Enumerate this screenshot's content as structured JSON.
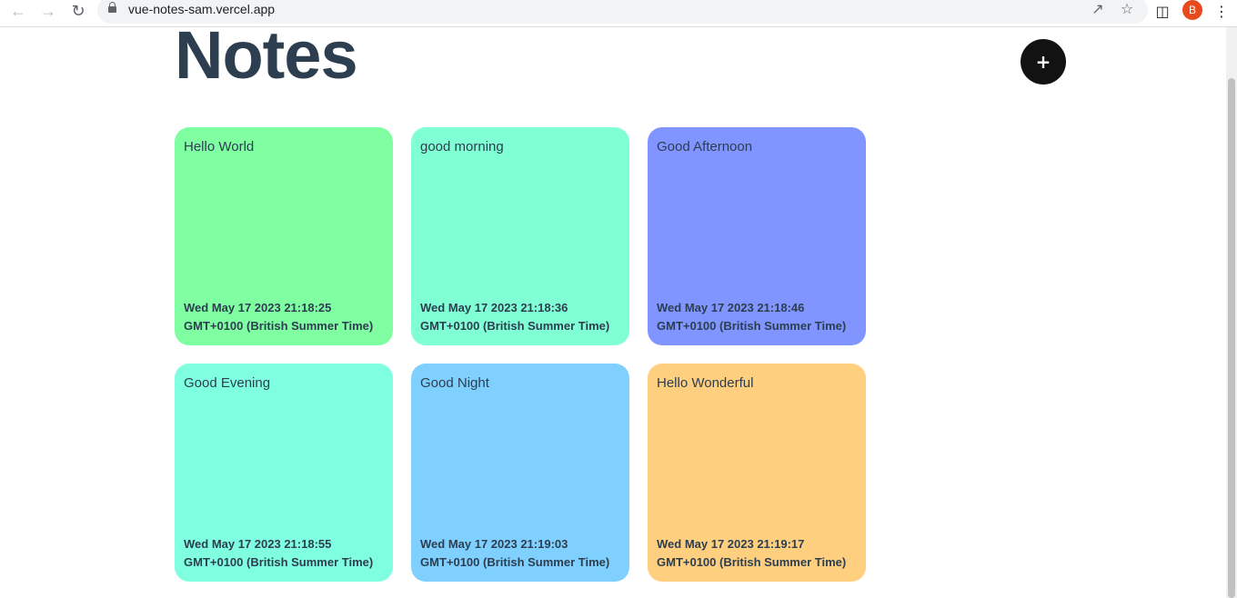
{
  "browser": {
    "url": "vue-notes-sam.vercel.app",
    "profile_initial": "B",
    "profile_color": "#e8491d"
  },
  "page": {
    "title": "Notes",
    "add_label": "+"
  },
  "notes": [
    {
      "text": "Hello World",
      "date": "Wed May 17 2023 21:18:25 GMT+0100 (British Summer Time)",
      "color": "#80ffa2"
    },
    {
      "text": "good morning",
      "date": "Wed May 17 2023 21:18:36 GMT+0100 (British Summer Time)",
      "color": "#80ffd4"
    },
    {
      "text": "Good Afternoon",
      "date": "Wed May 17 2023 21:18:46 GMT+0100 (British Summer Time)",
      "color": "#8095ff"
    },
    {
      "text": "Good Evening",
      "date": "Wed May 17 2023 21:18:55 GMT+0100 (British Summer Time)",
      "color": "#80ffe0"
    },
    {
      "text": "Good Night",
      "date": "Wed May 17 2023 21:19:03 GMT+0100 (British Summer Time)",
      "color": "#80d0ff"
    },
    {
      "text": "Hello Wonderful",
      "date": "Wed May 17 2023 21:19:17 GMT+0100 (British Summer Time)",
      "color": "#ffcf80"
    }
  ]
}
